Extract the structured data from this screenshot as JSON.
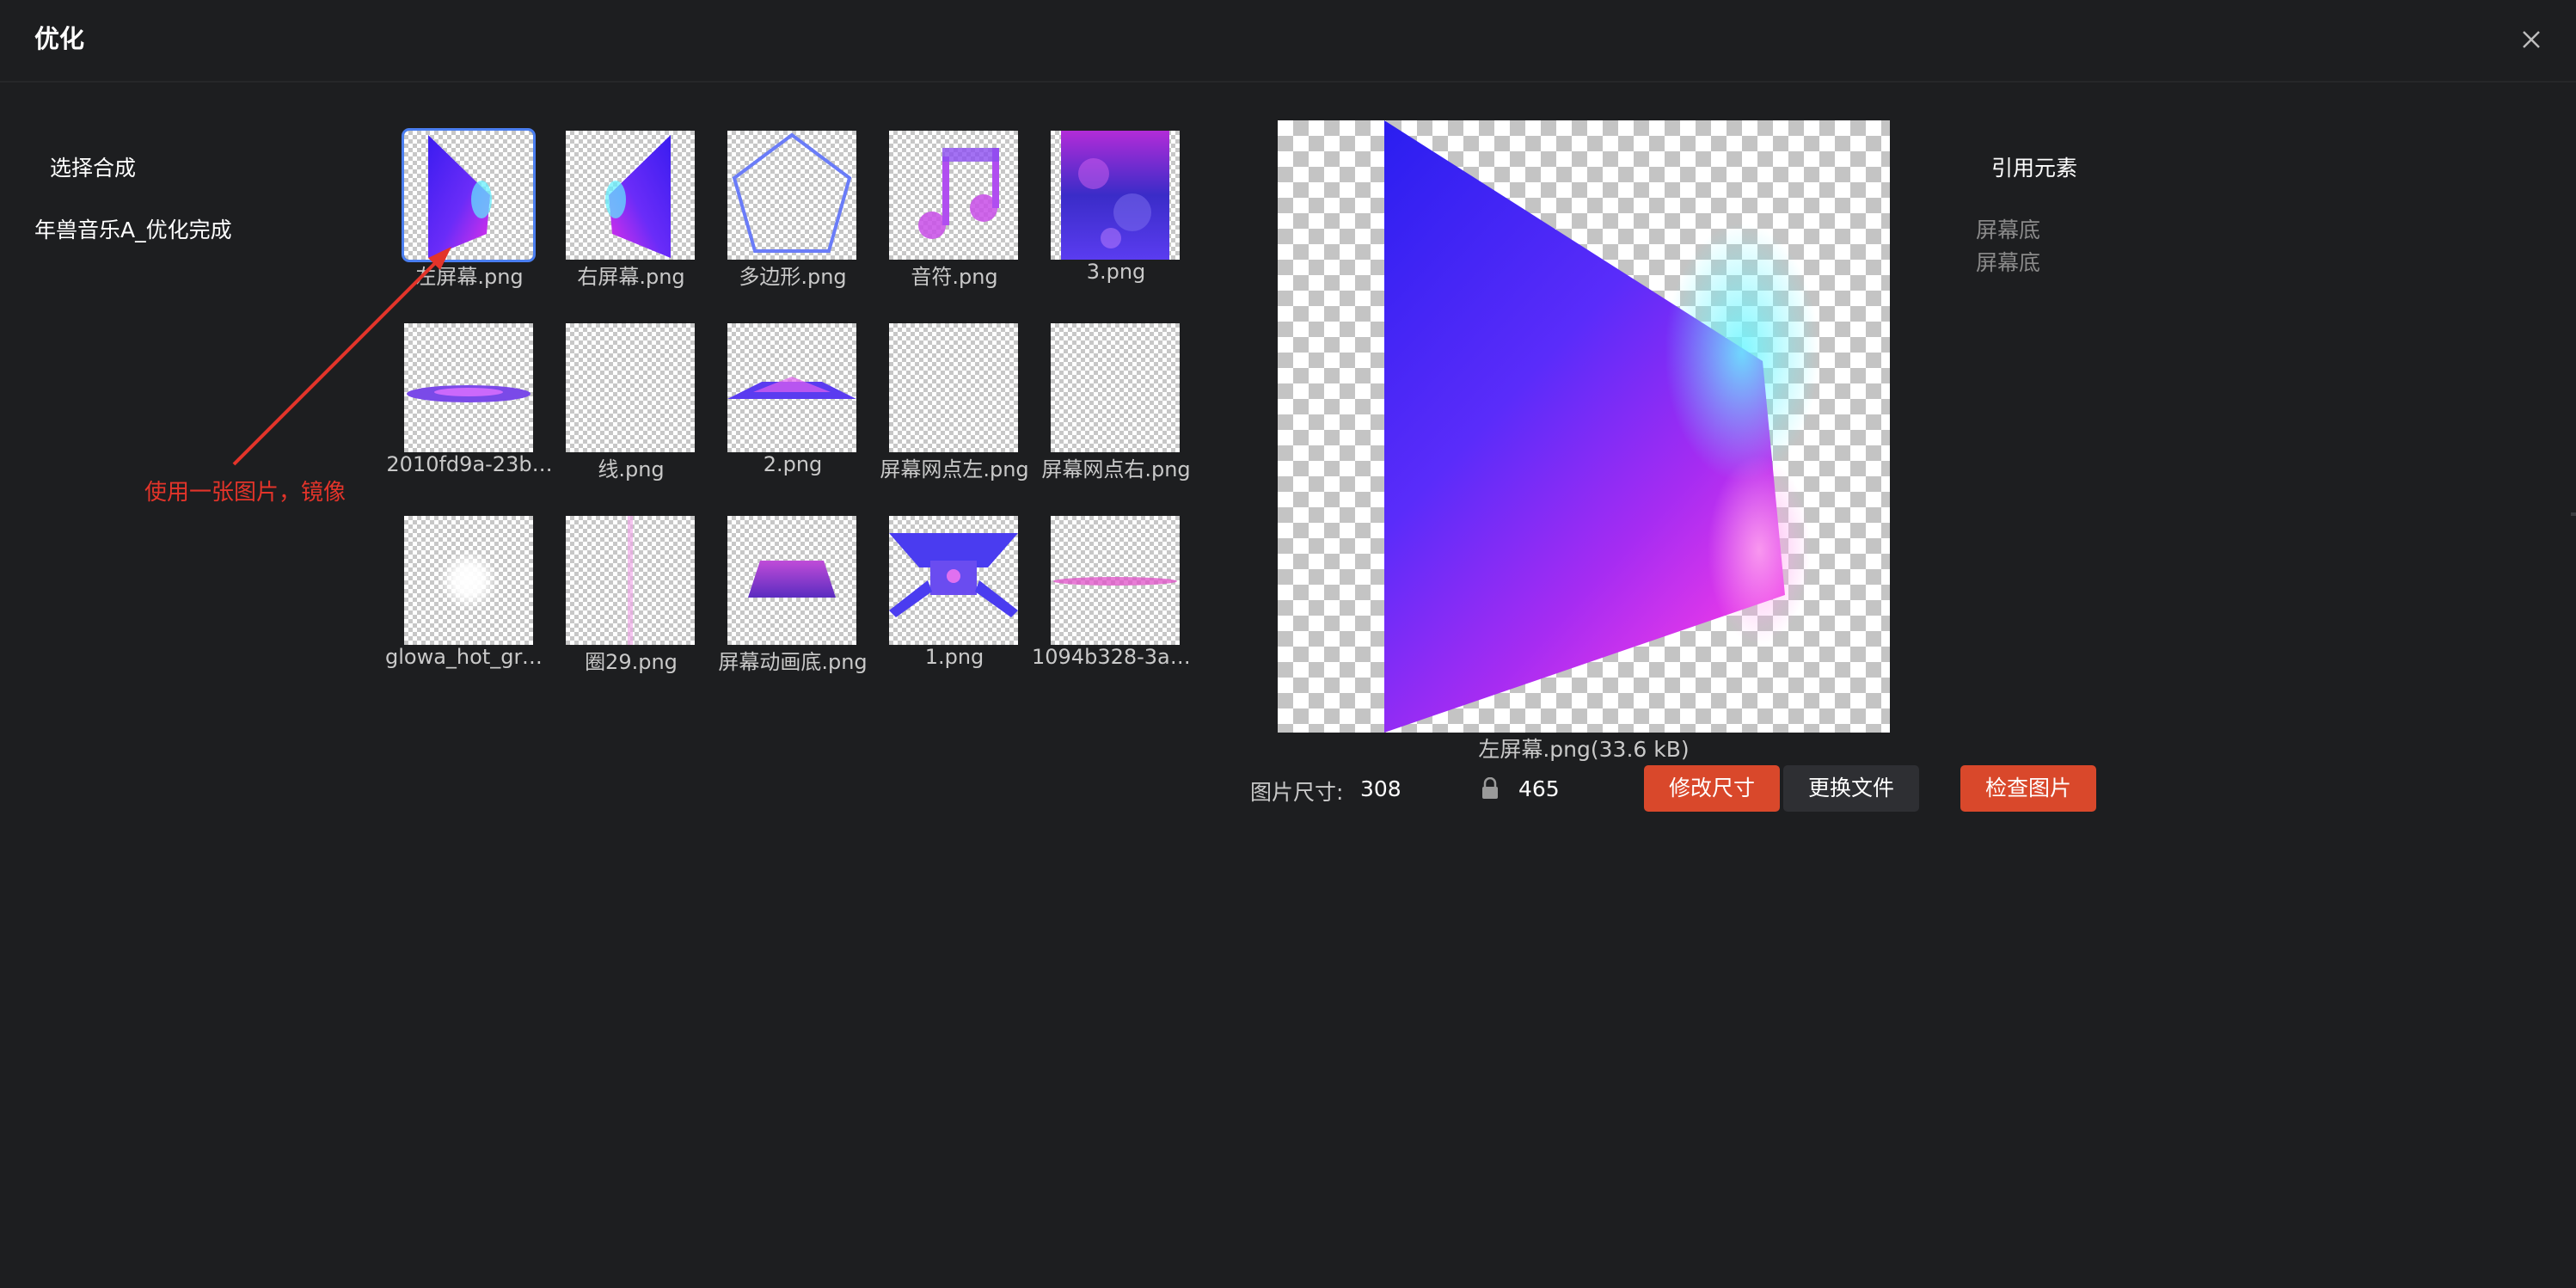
{
  "window": {
    "title": "优化",
    "close_icon": "close-icon"
  },
  "left_panel": {
    "section_label": "选择合成",
    "composition_name": "年兽音乐A_优化完成"
  },
  "annotation": {
    "text": "使用一张图片，镜像",
    "color": "#e3342a"
  },
  "assets": [
    {
      "name": "左屏幕.png",
      "selected": true
    },
    {
      "name": "右屏幕.png",
      "selected": false
    },
    {
      "name": "多边形.png",
      "selected": false
    },
    {
      "name": "音符.png",
      "selected": false
    },
    {
      "name": "3.png",
      "selected": false
    },
    {
      "name": "2010fd9a-23b…",
      "selected": false
    },
    {
      "name": "线.png",
      "selected": false
    },
    {
      "name": "2.png",
      "selected": false
    },
    {
      "name": "屏幕网点左.png",
      "selected": false
    },
    {
      "name": "屏幕网点右.png",
      "selected": false
    },
    {
      "name": "glowa_hot_gre…",
      "selected": false
    },
    {
      "name": "圈29.png",
      "selected": false
    },
    {
      "name": "屏幕动画底.png",
      "selected": false
    },
    {
      "name": "1.png",
      "selected": false
    },
    {
      "name": "1094b328-3ad…",
      "selected": false
    }
  ],
  "preview": {
    "caption": "左屏幕.png(33.6 kB)"
  },
  "size_controls": {
    "label": "图片尺寸:",
    "width": "308",
    "height": "465",
    "lock_icon": "lock-icon",
    "resize_button": "修改尺寸",
    "replace_button": "更换文件",
    "check_button": "检查图片"
  },
  "right_panel": {
    "title": "引用元素",
    "items": [
      "屏幕底",
      "屏幕底"
    ]
  },
  "colors": {
    "background": "#1d1e20",
    "accent_red": "#d9482b",
    "selection_blue": "#4a7ef0",
    "button_dark": "#2e2f33"
  }
}
